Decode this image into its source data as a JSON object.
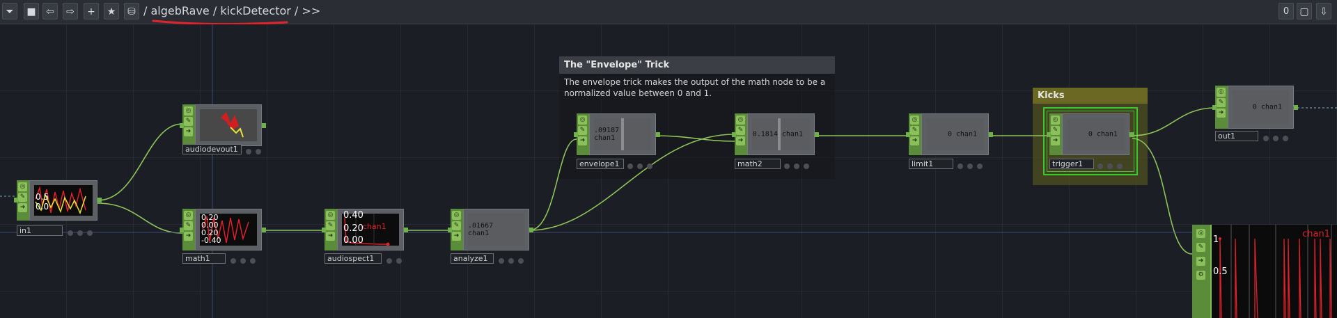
{
  "toolbar": {
    "buttons": [
      {
        "name": "menu-dropdown-button",
        "glyph": "⏷"
      },
      {
        "name": "stop-button",
        "glyph": "■"
      },
      {
        "name": "back-button",
        "glyph": "⇦"
      },
      {
        "name": "forward-button",
        "glyph": "⇨"
      },
      {
        "name": "add-button",
        "glyph": "+"
      },
      {
        "name": "favorite-button",
        "glyph": "★"
      },
      {
        "name": "save-button",
        "glyph": "⛁"
      }
    ],
    "path_prefix": "/ ",
    "path_root": "algebRave",
    "path_sep": " / ",
    "path_current": "kickDetector",
    "path_suffix": " / >>",
    "counter": "0",
    "right_buttons": [
      {
        "name": "maximize-button",
        "glyph": "▢"
      },
      {
        "name": "download-button",
        "glyph": "⇩"
      }
    ]
  },
  "annotations": {
    "envelope": {
      "title": "The \"Envelope\" Trick",
      "body": "The envelope trick makes the output of the math node to be a normalized value between 0 and 1."
    },
    "kicks": {
      "title": "Kicks"
    }
  },
  "nodes": {
    "in1": {
      "label": "in1"
    },
    "audiodevout1": {
      "label": "audiodevout1"
    },
    "math1": {
      "label": "math1"
    },
    "audiospect1": {
      "label": "audiospect1"
    },
    "analyze1": {
      "label": "analyze1",
      "value": ".01667 chan1"
    },
    "envelope1": {
      "label": "envelope1",
      "value": ".09187 chan1"
    },
    "math2": {
      "label": "math2",
      "value": "0.1814 chan1"
    },
    "limit1": {
      "label": "limit1",
      "value": "0 chan1"
    },
    "trigger1": {
      "label": "trigger1",
      "value": "0 chan1"
    },
    "out1": {
      "label": "out1",
      "value": "0 chan1"
    }
  },
  "viewers": {
    "in1": {
      "lines": [
        "0.5",
        "0.0"
      ]
    },
    "math1": {
      "lines": [
        "0.20",
        "0.00",
        "0.20",
        "-0.40"
      ]
    },
    "audiospect1": {
      "lines": [
        "0.40",
        "0.20",
        "0.00"
      ],
      "channel": "chan1"
    },
    "graph": {
      "channel": "chan1",
      "y_top": "1",
      "y_mid": "0.5"
    }
  },
  "colors": {
    "wire": "#8fc35b",
    "node_accent": "#5b8c3a",
    "annotation_kicks": "#5b5a1c",
    "annotation_envelope": "#3a3d42",
    "selection": "#3ac82e",
    "underline": "#e0242c",
    "chart_red": "#e0202a",
    "chart_yellow": "#e9e23a"
  }
}
